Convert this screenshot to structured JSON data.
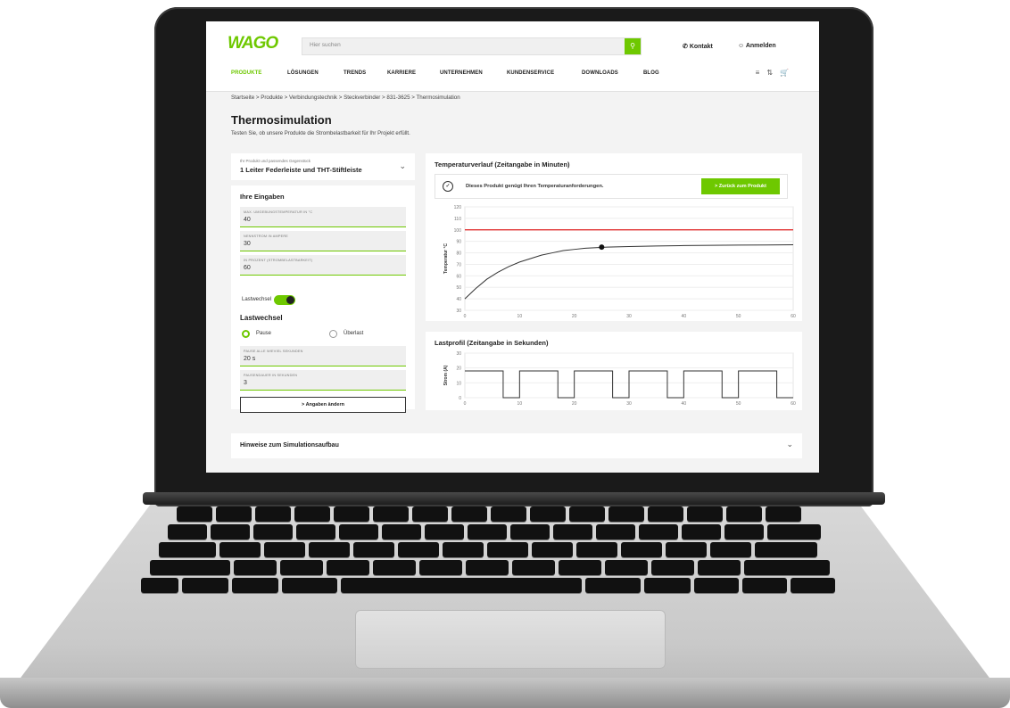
{
  "header": {
    "logo": "WAGO",
    "search_placeholder": "Hier suchen",
    "contact": "Kontakt",
    "login": "Anmelden"
  },
  "nav": [
    "PRODUKTE",
    "LÖSUNGEN",
    "TRENDS",
    "KARRIERE",
    "UNTERNEHMEN",
    "KUNDENSERVICE",
    "DOWNLOADS",
    "BLOG"
  ],
  "breadcrumb": "Startseite  >  Produkte  >  Verbindungstechnik  >  Steckverbinder  >  831-3625  >  Thermosimulation",
  "page": {
    "title": "Thermosimulation",
    "subtitle": "Testen Sie, ob unsere Produkte die Strombelastbarkeit für Ihr Projekt erfüllt."
  },
  "product_select": {
    "label": "Ihr Produkt und passendes Gegenstück",
    "value": "1 Leiter Federleiste und THT-Stiftleiste"
  },
  "inputs": {
    "title": "Ihre Eingaben",
    "fields": [
      {
        "label": "MAX. UMGEBUNGSTEMPERATUR IN °C",
        "value": "40"
      },
      {
        "label": "NENNSTROM IN AMPERE",
        "value": "30"
      },
      {
        "label": "IN PROZENT (STROMBELASTBARKEIT)",
        "value": "60"
      }
    ],
    "toggle_label": "Lastwechsel",
    "load_title": "Lastwechsel",
    "radio_pause": "Pause",
    "radio_overload": "Überlast",
    "fields2": [
      {
        "label": "PAUSE ALLE WIEVIEL SEKUNDEN",
        "value": "20 s"
      },
      {
        "label": "PAUSENDAUER IN SEKUNDEN",
        "value": "3"
      }
    ],
    "change_button": ">  Angaben ändern"
  },
  "temperature_panel": {
    "title": "Temperaturverlauf (Zeitangabe in Minuten)",
    "status": "Dieses Produkt genügt Ihren Temperaturanforderungen.",
    "back_button": ">  Zurück zum Produkt"
  },
  "load_panel": {
    "title": "Lastprofil (Zeitangabe in Sekunden)"
  },
  "accordion": {
    "title": "Hinweise zum Simulationsaufbau"
  },
  "chart_data": [
    {
      "type": "line",
      "title": "Temperaturverlauf (Zeitangabe in Minuten)",
      "ylabel": "Temperatur °C",
      "xlabel": "",
      "x_ticks": [
        0,
        10,
        20,
        30,
        40,
        50,
        60
      ],
      "y_ticks": [
        30,
        40,
        50,
        60,
        70,
        80,
        90,
        100,
        110,
        120
      ],
      "xlim": [
        0,
        60
      ],
      "ylim": [
        30,
        120
      ],
      "limit_line": {
        "value": 100,
        "color": "#e02020"
      },
      "series": [
        {
          "x": [
            0,
            2,
            4,
            6,
            8,
            10,
            12,
            14,
            16,
            18,
            20,
            22,
            24,
            26,
            30,
            35,
            40,
            45,
            50,
            55,
            60
          ],
          "y": [
            40,
            49,
            57,
            63,
            68,
            72,
            75,
            78,
            80,
            82,
            83,
            84,
            84.5,
            85,
            85.5,
            86,
            86.3,
            86.5,
            86.7,
            86.8,
            87
          ]
        }
      ],
      "marker": {
        "x": 25,
        "y": 85
      }
    },
    {
      "type": "line",
      "title": "Lastprofil (Zeitangabe in Sekunden)",
      "ylabel": "Strom (A)",
      "xlabel": "",
      "x_ticks": [
        0,
        10,
        20,
        30,
        40,
        50,
        60
      ],
      "y_ticks": [
        0,
        10,
        20,
        30
      ],
      "xlim": [
        0,
        60
      ],
      "ylim": [
        0,
        30
      ],
      "series": [
        {
          "x": [
            0,
            7,
            7,
            10,
            10,
            17,
            17,
            20,
            20,
            27,
            27,
            30,
            30,
            37,
            37,
            40,
            40,
            47,
            47,
            50,
            50,
            57,
            57,
            60
          ],
          "y": [
            18,
            18,
            0,
            0,
            18,
            18,
            0,
            0,
            18,
            18,
            0,
            0,
            18,
            18,
            0,
            0,
            18,
            18,
            0,
            0,
            18,
            18,
            0,
            0
          ]
        }
      ]
    }
  ]
}
